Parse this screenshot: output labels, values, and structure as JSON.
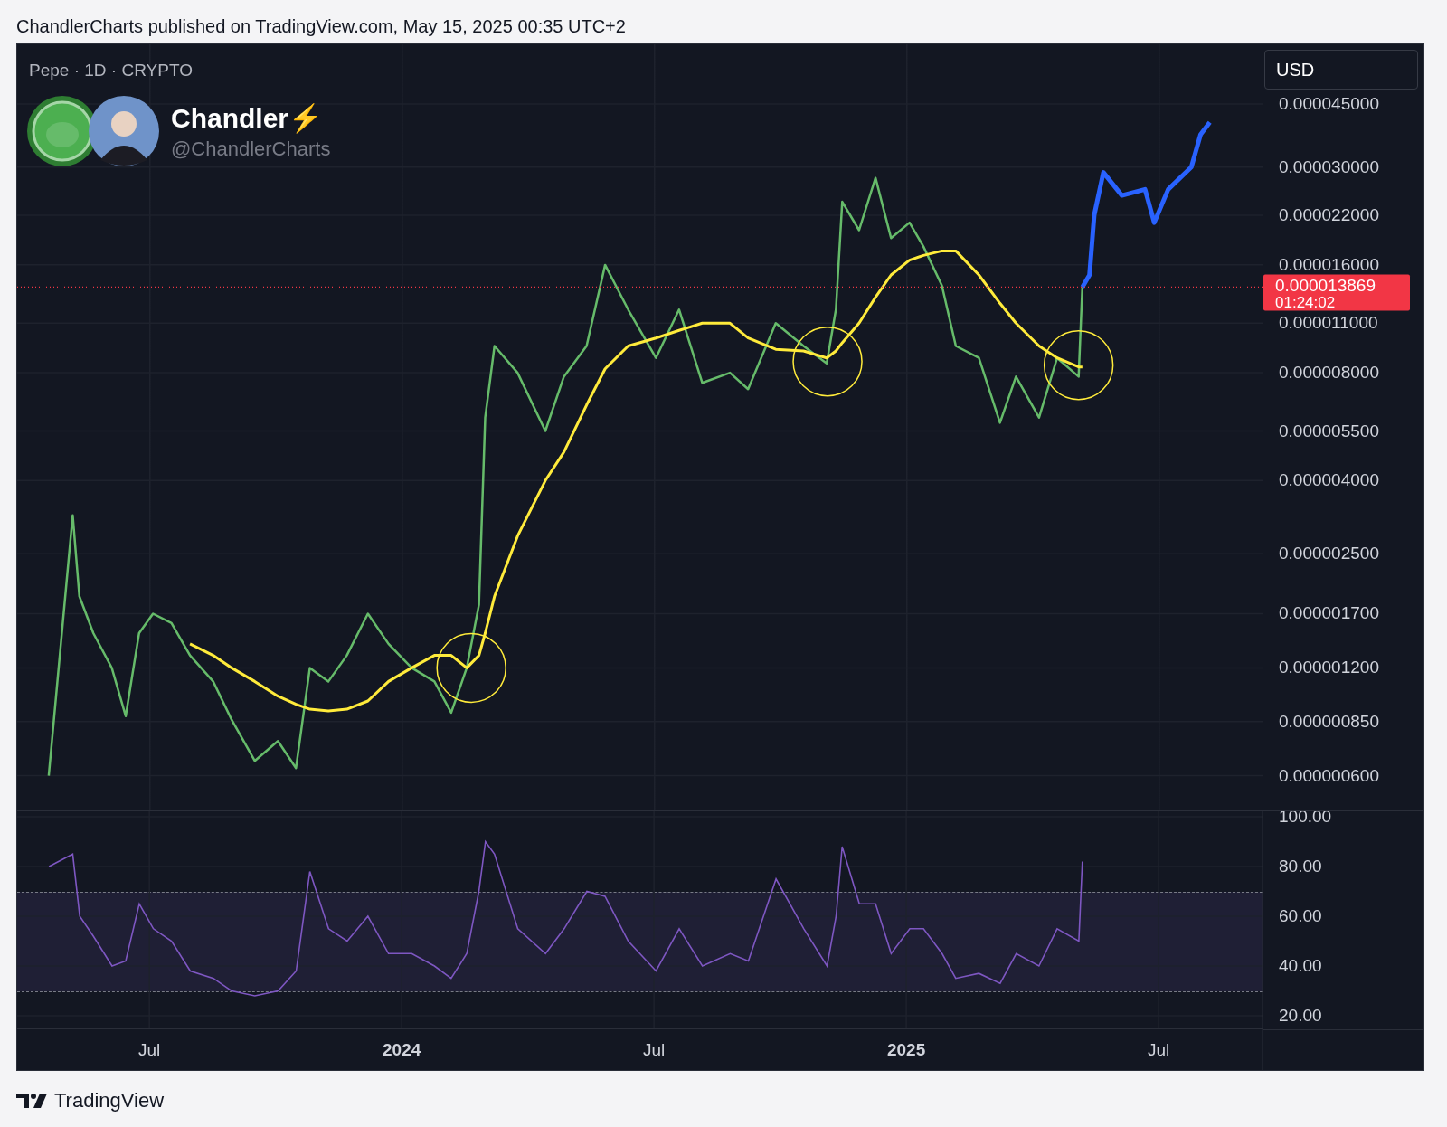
{
  "header": {
    "text": "ChandlerCharts published on TradingView.com, May 15, 2025 00:35 UTC+2"
  },
  "chart": {
    "legend": "Pepe · 1D · CRYPTO",
    "currency": "USD",
    "author": {
      "name": "Chandler⚡",
      "handle": "@ChandlerCharts"
    },
    "price_tag": {
      "price": "0.000013869",
      "countdown": "01:24:02"
    },
    "price_axis": [
      "0.000045000",
      "0.000030000",
      "0.000022000",
      "0.000016000",
      "0.000011000",
      "0.000008000",
      "0.000005500",
      "0.000004000",
      "0.000002500",
      "0.000001700",
      "0.000001200",
      "0.000000850",
      "0.000000600"
    ],
    "rsi_chart": {
      "chart_data": {
        "type": "line",
        "x": [
          2023.301,
          2023.348,
          2023.362,
          2023.389,
          2023.426,
          2023.453,
          2023.48,
          2023.508,
          2023.544,
          2023.581,
          2023.627,
          2023.663,
          2023.709,
          2023.755,
          2023.791,
          2023.818,
          2023.855,
          2023.892,
          2023.933,
          2023.974,
          2024.02,
          2024.065,
          2024.098,
          2024.129,
          2024.153,
          2024.166,
          2024.184,
          2024.23,
          2024.285,
          2024.322,
          2024.367,
          2024.403,
          2024.449,
          2024.504,
          2024.55,
          2024.596,
          2024.651,
          2024.687,
          2024.742,
          2024.797,
          2024.843,
          2024.861,
          2024.873,
          2024.907,
          2024.939,
          2024.97,
          2025.007,
          2025.034,
          2025.071,
          2025.098,
          2025.144,
          2025.186,
          2025.218,
          2025.263,
          2025.299,
          2025.342,
          2025.349
        ],
        "series": [
          {
            "color": "#7e57c2",
            "values": [
              80,
              85,
              60,
              52,
              40,
              42,
              65,
              55,
              50,
              38,
              35,
              30,
              28,
              30,
              38,
              78,
              55,
              50,
              60,
              45,
              45,
              40,
              35,
              45,
              70,
              90,
              85,
              55,
              45,
              55,
              70,
              68,
              50,
              38,
              55,
              40,
              45,
              42,
              75,
              55,
              40,
              60,
              88,
              65,
              65,
              45,
              55,
              55,
              45,
              35,
              37,
              33,
              45,
              40,
              55,
              50,
              82
            ]
          }
        ],
        "xlim": [
          2023.238,
          2025.706
        ],
        "ylim": [
          14.9,
          102.2
        ],
        "xticks": [
          {
            "value": 2023.5,
            "label": "Jul"
          },
          {
            "value": 2024,
            "label": "2024"
          },
          {
            "value": 2024.5,
            "label": "Jul"
          },
          {
            "value": 2025,
            "label": "2025"
          },
          {
            "value": 2025.5,
            "label": "Jul"
          }
        ],
        "yticks": [
          {
            "value": 100,
            "label": "100.00"
          },
          {
            "value": 80,
            "label": "80.00"
          },
          {
            "value": 60,
            "label": "60.00"
          },
          {
            "value": 40,
            "label": "40.00"
          },
          {
            "value": 20,
            "label": "20.00"
          }
        ],
        "grid": true
      }
    }
  },
  "footer": {
    "brand": "TradingView"
  }
}
